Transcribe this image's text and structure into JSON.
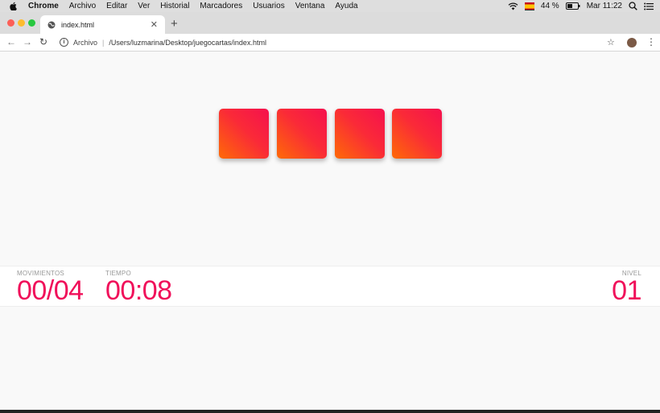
{
  "menubar": {
    "app_name": "Chrome",
    "items": [
      "Archivo",
      "Editar",
      "Ver",
      "Historial",
      "Marcadores",
      "Usuarios",
      "Ventana",
      "Ayuda"
    ],
    "battery": "44 %",
    "clock": "Mar 11:22"
  },
  "browser": {
    "tab_title": "index.html",
    "scheme_label": "Archivo",
    "url": "/Users/luzmarina/Desktop/juegocartas/index.html",
    "traffic_colors": [
      "#fc5f57",
      "#fdbc2e",
      "#28c840"
    ]
  },
  "game": {
    "card_count": 4,
    "card_gradient": [
      "#f5114e",
      "#fe6a07"
    ],
    "stats": {
      "moves_label": "MOVIMIENTOS",
      "moves_value": "00/04",
      "time_label": "TIEMPO",
      "time_value": "00:08",
      "level_label": "NIVEL",
      "level_value": "01"
    },
    "accent_color": "#f0105a"
  }
}
